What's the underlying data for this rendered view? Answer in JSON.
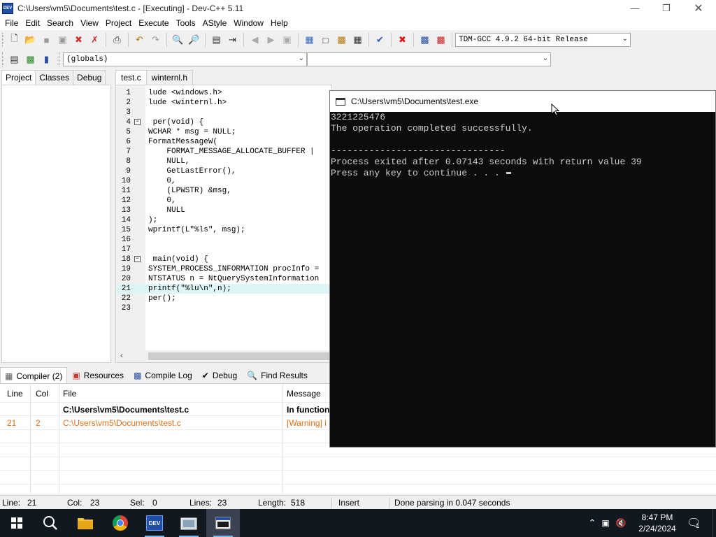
{
  "window": {
    "title": "C:\\Users\\vm5\\Documents\\test.c - [Executing] - Dev-C++ 5.11",
    "logo_text": "DEV"
  },
  "menu": [
    "File",
    "Edit",
    "Search",
    "View",
    "Project",
    "Execute",
    "Tools",
    "AStyle",
    "Window",
    "Help"
  ],
  "compiler_select": "TDM-GCC 4.9.2 64-bit Release",
  "scope_select": "(globals)",
  "symbol_select": "",
  "left_tabs": [
    "Project",
    "Classes",
    "Debug"
  ],
  "editor_tabs": [
    "test.c",
    "winternl.h"
  ],
  "code_lines": [
    {
      "n": "1",
      "fold": "",
      "text": "lude <windows.h>"
    },
    {
      "n": "2",
      "fold": "",
      "text": "lude <winternl.h>"
    },
    {
      "n": "3",
      "fold": "",
      "text": ""
    },
    {
      "n": "4",
      "fold": "−",
      "text": " per(void) {"
    },
    {
      "n": "5",
      "fold": "",
      "text": "WCHAR * msg = NULL;"
    },
    {
      "n": "6",
      "fold": "",
      "text": "FormatMessageW("
    },
    {
      "n": "7",
      "fold": "",
      "text": "    FORMAT_MESSAGE_ALLOCATE_BUFFER |"
    },
    {
      "n": "8",
      "fold": "",
      "text": "    NULL,"
    },
    {
      "n": "9",
      "fold": "",
      "text": "    GetLastError(),"
    },
    {
      "n": "10",
      "fold": "",
      "text": "    0,"
    },
    {
      "n": "11",
      "fold": "",
      "text": "    (LPWSTR) &msg,"
    },
    {
      "n": "12",
      "fold": "",
      "text": "    0,"
    },
    {
      "n": "13",
      "fold": "",
      "text": "    NULL"
    },
    {
      "n": "14",
      "fold": "",
      "text": ");"
    },
    {
      "n": "15",
      "fold": "",
      "text": "wprintf(L\"%ls\", msg);"
    },
    {
      "n": "16",
      "fold": "",
      "text": ""
    },
    {
      "n": "17",
      "fold": "",
      "text": ""
    },
    {
      "n": "18",
      "fold": "−",
      "text": " main(void) {"
    },
    {
      "n": "19",
      "fold": "",
      "text": "SYSTEM_PROCESS_INFORMATION procInfo ="
    },
    {
      "n": "20",
      "fold": "",
      "text": "NTSTATUS n = NtQuerySystemInformation"
    },
    {
      "n": "21",
      "fold": "",
      "text": "printf(\"%lu\\n\",n);"
    },
    {
      "n": "22",
      "fold": "",
      "text": "per();"
    },
    {
      "n": "23",
      "fold": "",
      "text": ""
    }
  ],
  "console": {
    "title": "C:\\Users\\vm5\\Documents\\test.exe",
    "lines": [
      "3221225476",
      "The operation completed successfully.",
      "",
      "--------------------------------",
      "Process exited after 0.07143 seconds with return value 39",
      "Press any key to continue . . . "
    ]
  },
  "bottom_tabs": [
    "Compiler (2)",
    "Resources",
    "Compile Log",
    "Debug",
    "Find Results"
  ],
  "results": {
    "headers": {
      "line": "Line",
      "col": "Col",
      "file": "File",
      "message": "Message"
    },
    "rows": [
      {
        "line": "",
        "col": "",
        "file": "C:\\Users\\vm5\\Documents\\test.c",
        "message": "In function"
      },
      {
        "line": "21",
        "col": "2",
        "file": "C:\\Users\\vm5\\Documents\\test.c",
        "message": "[Warning] i"
      }
    ],
    "warning_color": "#e0701a"
  },
  "status": {
    "line_label": "Line:",
    "line_value": "21",
    "col_label": "Col:",
    "col_value": "23",
    "sel_label": "Sel:",
    "sel_value": "0",
    "lines_label": "Lines:",
    "lines_value": "23",
    "length_label": "Length:",
    "length_value": "518",
    "mode": "Insert",
    "message": "Done parsing in 0.047 seconds"
  },
  "taskbar": {
    "time": "8:47 PM",
    "date": "2/24/2024",
    "notification_count": "1",
    "dev_logo_text": "DEV"
  }
}
